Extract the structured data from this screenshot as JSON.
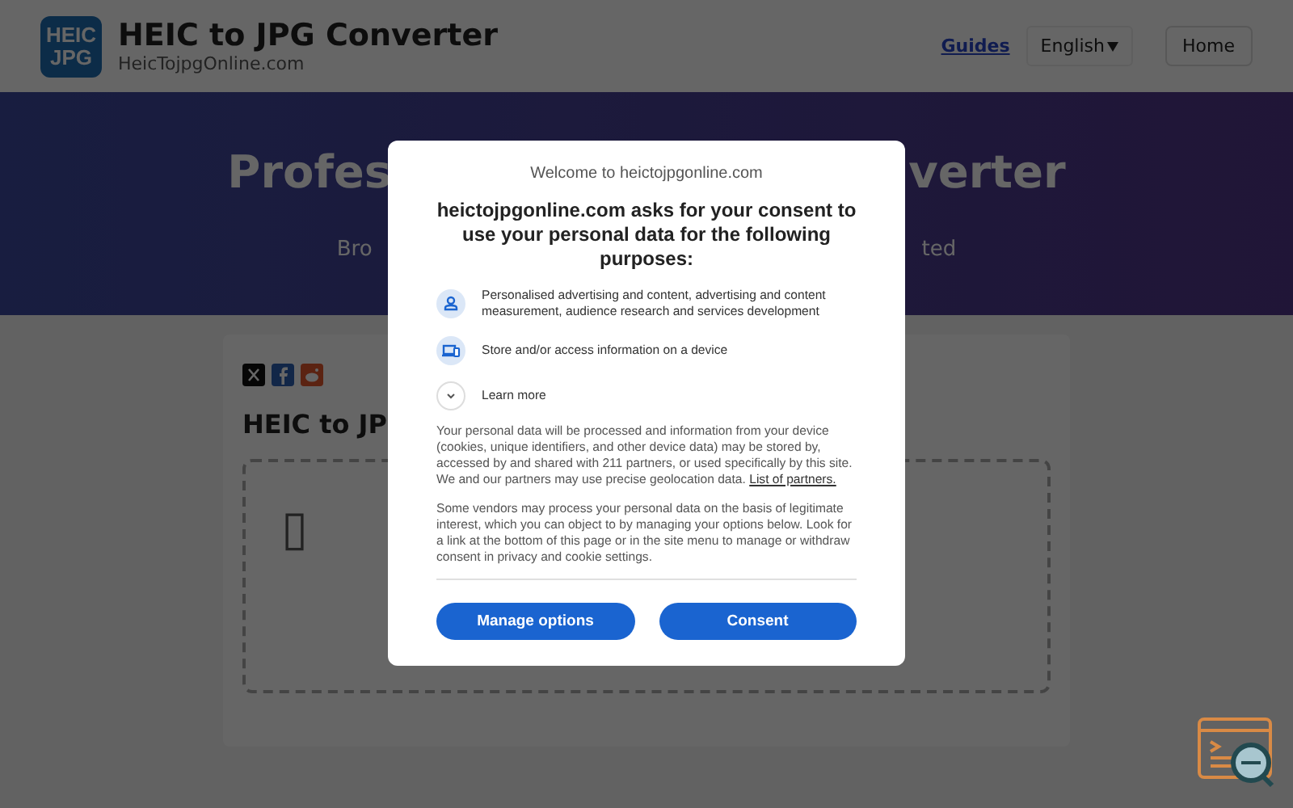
{
  "header": {
    "logo": {
      "line_1": "HEIC",
      "line_2": "JPG"
    },
    "title": "HEIC to JPG Converter",
    "subtitle": "HeicTojpgOnline.com",
    "nav": [
      {
        "kind": "link",
        "label": "Guides"
      },
      {
        "kind": "dropdown",
        "label": "English"
      },
      {
        "kind": "button",
        "label": "Home"
      }
    ]
  },
  "hero": {
    "title_fragments": [
      "Profes",
      "verter"
    ],
    "subtitle_fragments": [
      "Bro",
      "ted"
    ]
  },
  "card": {
    "share_icons": [
      {
        "kind": "x"
      },
      {
        "kind": "facebook"
      },
      {
        "kind": "reddit"
      }
    ],
    "title": "HEIC to JP",
    "dropzone_glyph": "▯"
  },
  "consent": {
    "welcome": "Welcome to heictojpgonline.com",
    "heading": "heictojpgonline.com asks for your consent to use your personal data for the following purposes:",
    "purposes": [
      {
        "kind": "person",
        "text": "Personalised advertising and content, advertising and content measurement, audience research and services development"
      },
      {
        "kind": "device",
        "text": "Store and/or access information on a device"
      }
    ],
    "learn_more": "Learn more",
    "paragraphs": [
      {
        "text": "Your personal data will be processed and information from your device (cookies, unique identifiers, and other device data) may be stored by, accessed by and shared with 211 partners, or used specifically by this site. We and our partners may use precise geolocation data.",
        "link": "List of partners."
      },
      {
        "text": "Some vendors may process your personal data on the basis of legitimate interest, which you can object to by managing your options below. Look for a link at the bottom of this page or in the site menu to manage or withdraw consent in privacy and cookie settings."
      }
    ],
    "buttons": [
      "Manage options",
      "Consent"
    ]
  }
}
